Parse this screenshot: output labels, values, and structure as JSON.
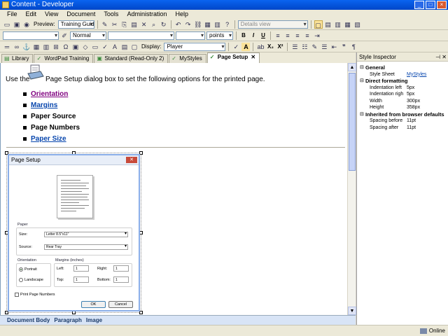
{
  "window": {
    "title": "Content - Developer",
    "controls": [
      "_",
      "□",
      "×"
    ]
  },
  "menu": [
    "File",
    "Edit",
    "View",
    "Document",
    "Tools",
    "Administration",
    "Help"
  ],
  "toolbar1": {
    "preview_label": "Preview:",
    "preview_value": "Training Guide",
    "view_value": "Details view"
  },
  "toolbar2": {
    "style_value": "Normal",
    "size_unit": "points",
    "bold": "B",
    "italic": "I",
    "underline": "U"
  },
  "toolbar3": {
    "display_label": "Display:",
    "display_value": "Player",
    "sub": "X₂",
    "sup": "X²"
  },
  "tabs": [
    {
      "label": "Library",
      "active": false
    },
    {
      "label": "WordPad Training",
      "active": false
    },
    {
      "label": "Standard (Read-Only 2)",
      "active": false
    },
    {
      "label": "MyStyles",
      "active": false
    },
    {
      "label": "Page Setup",
      "active": true
    }
  ],
  "doc": {
    "intro_before": "Use the",
    "intro_after": "Page Setup dialog box to set the following options for the printed page.",
    "bullets": [
      {
        "text": "Orientation",
        "style": "visited"
      },
      {
        "text": "Margins",
        "style": "link"
      },
      {
        "text": "Paper Source",
        "style": "plain"
      },
      {
        "text": "Page Numbers",
        "style": "plain"
      },
      {
        "text": "Paper Size",
        "style": "link"
      }
    ]
  },
  "dialog": {
    "title": "Page Setup",
    "paper_label": "Paper",
    "size_label": "Size:",
    "size_value": "Letter 8.5\"x11\"",
    "source_label": "Source:",
    "source_value": "Rear Tray",
    "orientation_label": "Orientation",
    "portrait": "Portrait",
    "landscape": "Landscape",
    "margins_label": "Margins (inches)",
    "left": "Left:",
    "right": "Right:",
    "top": "Top:",
    "bottom": "Bottom:",
    "left_val": "1",
    "right_val": "1",
    "top_val": "1",
    "bottom_val": "1",
    "print_page_numbers": "Print Page Numbers",
    "ok": "OK",
    "cancel": "Cancel"
  },
  "breadcrumb": [
    "Document Body",
    "Paragraph",
    "Image"
  ],
  "inspector": {
    "title": "Style Inspector",
    "general": "General",
    "style_sheet_key": "Style Sheet",
    "style_sheet_val": "MyStyles",
    "direct": "Direct formatting",
    "rows": [
      {
        "k": "Indentation left",
        "v": "5px"
      },
      {
        "k": "Indentation righ",
        "v": "5px"
      },
      {
        "k": "Width",
        "v": "300px"
      },
      {
        "k": "Height",
        "v": "358px"
      }
    ],
    "inherited": "Inherited from browser defaults",
    "rows2": [
      {
        "k": "Spacing before",
        "v": "11pt"
      },
      {
        "k": "Spacing after",
        "v": "11pt"
      }
    ]
  },
  "status": {
    "online": "Online"
  }
}
